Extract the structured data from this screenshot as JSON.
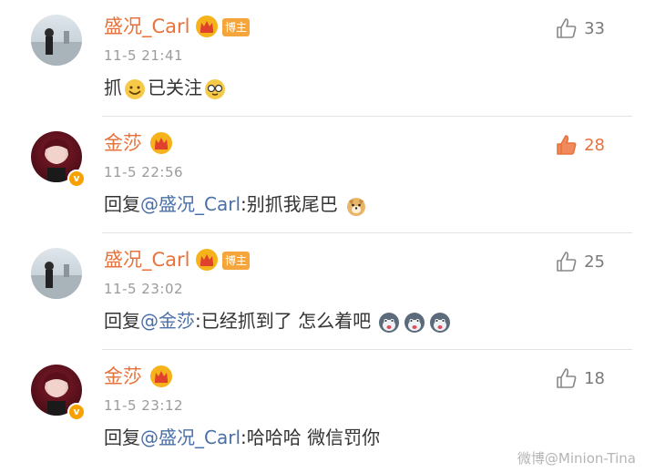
{
  "comments": [
    {
      "name": "盛况_Carl",
      "badge": "博主",
      "time": "11-5 21:41",
      "likes": "33",
      "liked": false,
      "text_before": "抓",
      "text_after": "已关注",
      "emojis": [
        "grin-emoji",
        "nerd-emoji"
      ]
    },
    {
      "name": "金莎",
      "verified": "v",
      "time": "11-5 22:56",
      "likes": "28",
      "liked": true,
      "reply_prefix": "回复",
      "mention": "@盛况_Carl",
      "text": ":别抓我尾巴",
      "emojis": [
        "doge-emoji"
      ]
    },
    {
      "name": "盛况_Carl",
      "badge": "博主",
      "time": "11-5 23:02",
      "likes": "25",
      "liked": false,
      "reply_prefix": "回复",
      "mention": "@金莎",
      "text": ":已经抓到了 怎么着吧",
      "emojis": [
        "husky-emoji",
        "husky-emoji",
        "husky-emoji"
      ]
    },
    {
      "name": "金莎",
      "verified": "v",
      "time": "11-5 23:12",
      "likes": "18",
      "liked": false,
      "reply_prefix": "回复",
      "mention": "@盛况_Carl",
      "text": ":哈哈哈 微信罚你"
    }
  ],
  "watermark": "微博@Minion-Tina",
  "colors": {
    "accent": "#e8723b",
    "mention": "#4a6fa8",
    "time": "#9b9b9b"
  }
}
